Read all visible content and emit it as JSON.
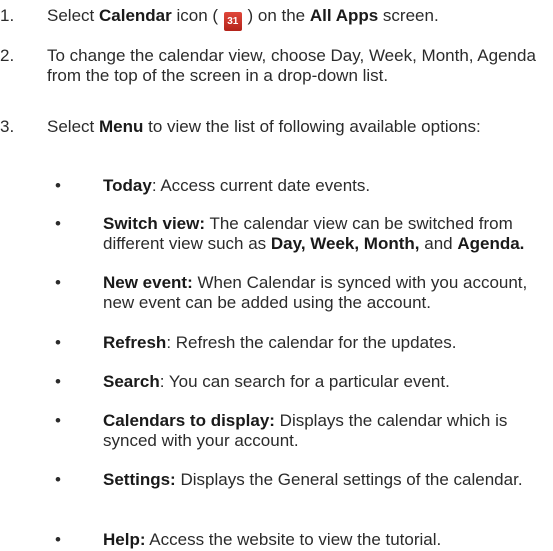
{
  "steps": [
    {
      "num": "1.",
      "pre": "Select ",
      "bold1": "Calendar",
      "mid1": " icon ( ",
      "icon_text": "31",
      "mid2": " ) on the ",
      "bold2": "All Apps",
      "post": " screen."
    },
    {
      "num": "2.",
      "text": "To change the calendar view, choose Day, Week, Month, Agenda from the top of the screen in a drop-down list."
    },
    {
      "num": "3.",
      "pre": "Select ",
      "bold": "Menu",
      "post": " to view the list of following available options:"
    }
  ],
  "options": [
    {
      "bold": "Today",
      "rest": ": Access current date events."
    },
    {
      "bold": "Switch view:",
      "rest": " The calendar view can be switched from different view such as ",
      "b1": "Day, Week, Month,",
      "mid": " and ",
      "b2": "Agenda."
    },
    {
      "bold": "New event:",
      "rest": " When Calendar is synced with you account, new event can be added using the account."
    },
    {
      "bold": "Refresh",
      "rest": ": Refresh the calendar for the updates."
    },
    {
      "bold": "Search",
      "rest": ": You can search for a particular event."
    },
    {
      "bold": "Calendars to display:",
      "rest": " Displays the calendar which is synced with your account."
    },
    {
      "bold": "Settings:",
      "rest": " Displays the General settings of the calendar."
    },
    {
      "bold": "Help:",
      "rest": " Access the website to view the tutorial."
    }
  ],
  "bullet_char": "•",
  "colors": {
    "icon_bg": "#c8302a",
    "text": "#2b2b2b"
  },
  "icons": {
    "calendar": "calendar-app-icon"
  }
}
